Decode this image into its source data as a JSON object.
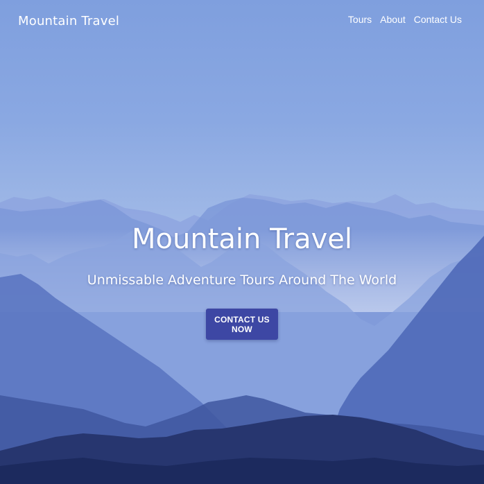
{
  "nav": {
    "brand": "Mountain Travel",
    "links": [
      "Tours",
      "About",
      "Contact Us"
    ]
  },
  "hero": {
    "title": "Mountain Travel",
    "subtitle": "Unmissable Adventure Tours Around The World",
    "cta_label": "CONTACT US NOW"
  },
  "colors": {
    "sky_top": "#7f9fde",
    "horizon": "#c9d3f0",
    "button": "#3d47a4",
    "mountain_dark": "#1c2a5e"
  }
}
